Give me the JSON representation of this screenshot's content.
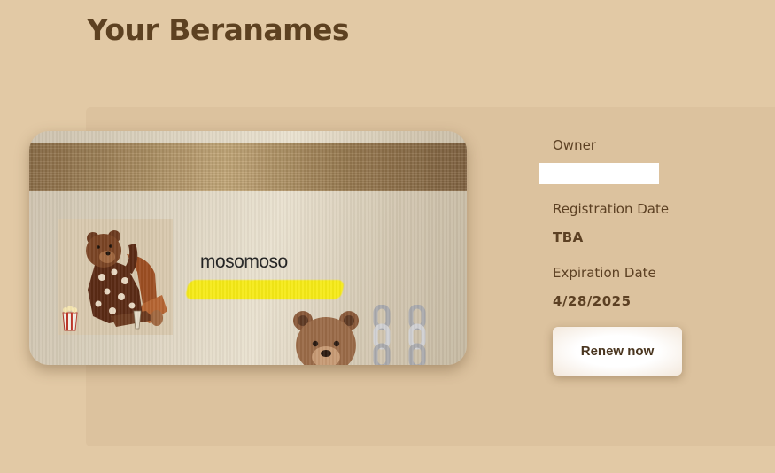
{
  "page": {
    "title": "Your Beranames"
  },
  "card": {
    "domain_name": "mosomoso",
    "art_icon": "bear-with-flower-shirt-illustration",
    "emoji_icon": "bear-face-emoji",
    "chain_icon": "chain-link-icon"
  },
  "details": {
    "owner_label": "Owner",
    "owner_value_redacted": true,
    "registration_label": "Registration Date",
    "registration_value": "TBA",
    "expiration_label": "Expiration Date",
    "expiration_value": "4/28/2025",
    "renew_button_label": "Renew now"
  },
  "colors": {
    "background": "#e2c9a5",
    "panel": "#dcc29e",
    "text_brown": "#5c4023",
    "title_brown": "#5d4121",
    "highlight_yellow": "#f6ea17"
  }
}
